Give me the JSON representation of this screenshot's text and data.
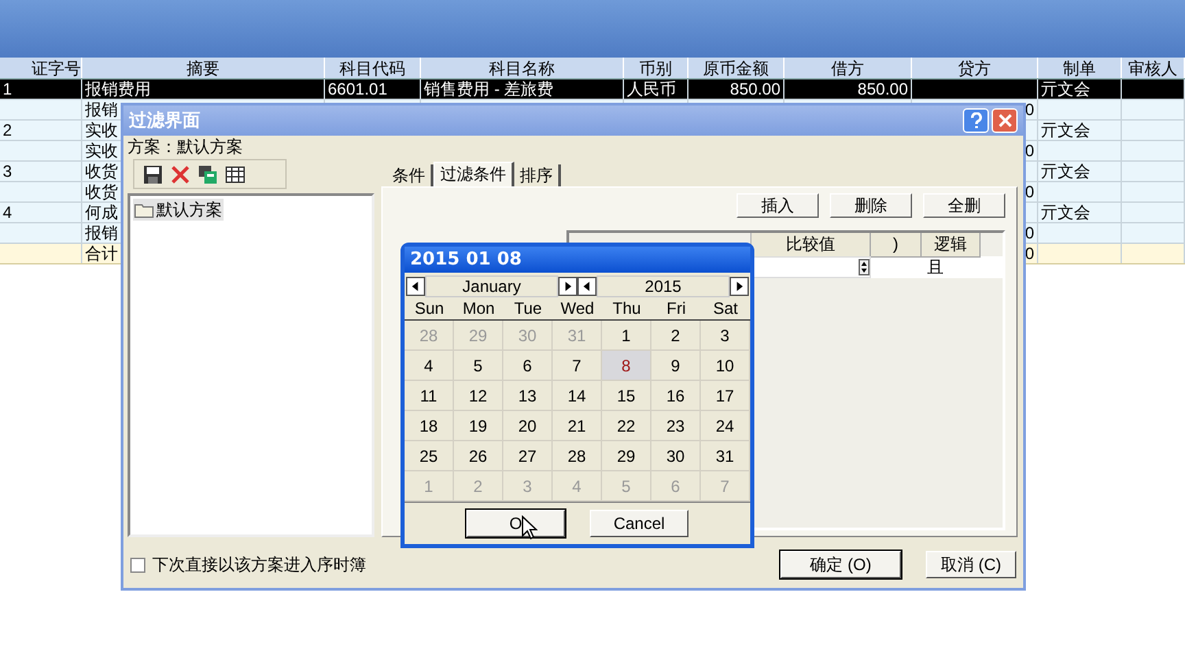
{
  "background_table": {
    "columns": [
      "证字号",
      "摘要",
      "科目代码",
      "科目名称",
      "币别",
      "原币金额",
      "借方",
      "贷方",
      "制单",
      "审核人"
    ],
    "rows": [
      {
        "kind": "entry",
        "selected": true,
        "voucher_no": "1",
        "summary": "报销费用",
        "account_code": "6601.01",
        "account_name": "销售费用 - 差旅费",
        "currency": "人民币",
        "amount": "850.00",
        "debit": "850.00",
        "preparer": "亓文会"
      },
      {
        "kind": "entry",
        "selected": false,
        "summary": "报销",
        "credit": "0"
      },
      {
        "kind": "entry",
        "selected": false,
        "voucher_no": "2",
        "summary": "实收",
        "preparer": "亓文会"
      },
      {
        "kind": "entry",
        "selected": false,
        "summary": "实收",
        "credit": "0"
      },
      {
        "kind": "entry",
        "selected": false,
        "voucher_no": "3",
        "summary": "收货",
        "preparer": "亓文会"
      },
      {
        "kind": "entry",
        "selected": false,
        "summary": "收货",
        "credit": "0"
      },
      {
        "kind": "entry",
        "selected": false,
        "voucher_no": "4",
        "summary": "何成",
        "preparer": "亓文会"
      },
      {
        "kind": "entry",
        "selected": false,
        "summary": "报销",
        "credit": "0"
      },
      {
        "kind": "total",
        "selected": false,
        "summary": "合计",
        "credit": "0"
      }
    ]
  },
  "dialog": {
    "title": "过滤界面",
    "scheme_label": "方案：默认方案",
    "schemes": [
      {
        "label": "默认方案",
        "selected": true
      }
    ],
    "tabs": [
      {
        "label": "条件",
        "selected": false
      },
      {
        "label": "过滤条件",
        "selected": true
      },
      {
        "label": "排序",
        "selected": false
      }
    ],
    "grid_buttons": [
      "插入",
      "删除",
      "全删"
    ],
    "grid_columns": [
      "比较值",
      ")",
      "逻辑"
    ],
    "grid_rows": [
      {
        "logic": "且"
      }
    ],
    "remember_checkbox": {
      "label": "下次直接以该方案进入序时簿",
      "checked": false
    },
    "buttons": [
      "确定 (O)",
      "取消 (C)"
    ]
  },
  "date_picker": {
    "title": "2015 01 08",
    "month": "January",
    "year": "2015",
    "weekdays": [
      "Sun",
      "Mon",
      "Tue",
      "Wed",
      "Thu",
      "Fri",
      "Sat"
    ],
    "days": [
      {
        "text": "28",
        "muted": true,
        "selected": false
      },
      {
        "text": "29",
        "muted": true,
        "selected": false
      },
      {
        "text": "30",
        "muted": true,
        "selected": false
      },
      {
        "text": "31",
        "muted": true,
        "selected": false
      },
      {
        "text": "1",
        "muted": false,
        "selected": false
      },
      {
        "text": "2",
        "muted": false,
        "selected": false
      },
      {
        "text": "3",
        "muted": false,
        "selected": false
      },
      {
        "text": "4",
        "muted": false,
        "selected": false
      },
      {
        "text": "5",
        "muted": false,
        "selected": false
      },
      {
        "text": "6",
        "muted": false,
        "selected": false
      },
      {
        "text": "7",
        "muted": false,
        "selected": false
      },
      {
        "text": "8",
        "muted": false,
        "selected": true
      },
      {
        "text": "9",
        "muted": false,
        "selected": false
      },
      {
        "text": "10",
        "muted": false,
        "selected": false
      },
      {
        "text": "11",
        "muted": false,
        "selected": false
      },
      {
        "text": "12",
        "muted": false,
        "selected": false
      },
      {
        "text": "13",
        "muted": false,
        "selected": false
      },
      {
        "text": "14",
        "muted": false,
        "selected": false
      },
      {
        "text": "15",
        "muted": false,
        "selected": false
      },
      {
        "text": "16",
        "muted": false,
        "selected": false
      },
      {
        "text": "17",
        "muted": false,
        "selected": false
      },
      {
        "text": "18",
        "muted": false,
        "selected": false
      },
      {
        "text": "19",
        "muted": false,
        "selected": false
      },
      {
        "text": "20",
        "muted": false,
        "selected": false
      },
      {
        "text": "21",
        "muted": false,
        "selected": false
      },
      {
        "text": "22",
        "muted": false,
        "selected": false
      },
      {
        "text": "23",
        "muted": false,
        "selected": false
      },
      {
        "text": "24",
        "muted": false,
        "selected": false
      },
      {
        "text": "25",
        "muted": false,
        "selected": false
      },
      {
        "text": "26",
        "muted": false,
        "selected": false
      },
      {
        "text": "27",
        "muted": false,
        "selected": false
      },
      {
        "text": "28",
        "muted": false,
        "selected": false
      },
      {
        "text": "29",
        "muted": false,
        "selected": false
      },
      {
        "text": "30",
        "muted": false,
        "selected": false
      },
      {
        "text": "31",
        "muted": false,
        "selected": false
      },
      {
        "text": "1",
        "muted": true,
        "selected": false
      },
      {
        "text": "2",
        "muted": true,
        "selected": false
      },
      {
        "text": "3",
        "muted": true,
        "selected": false
      },
      {
        "text": "4",
        "muted": true,
        "selected": false
      },
      {
        "text": "5",
        "muted": true,
        "selected": false
      },
      {
        "text": "6",
        "muted": true,
        "selected": false
      },
      {
        "text": "7",
        "muted": true,
        "selected": false
      }
    ],
    "buttons": [
      "O",
      "Cancel"
    ]
  }
}
